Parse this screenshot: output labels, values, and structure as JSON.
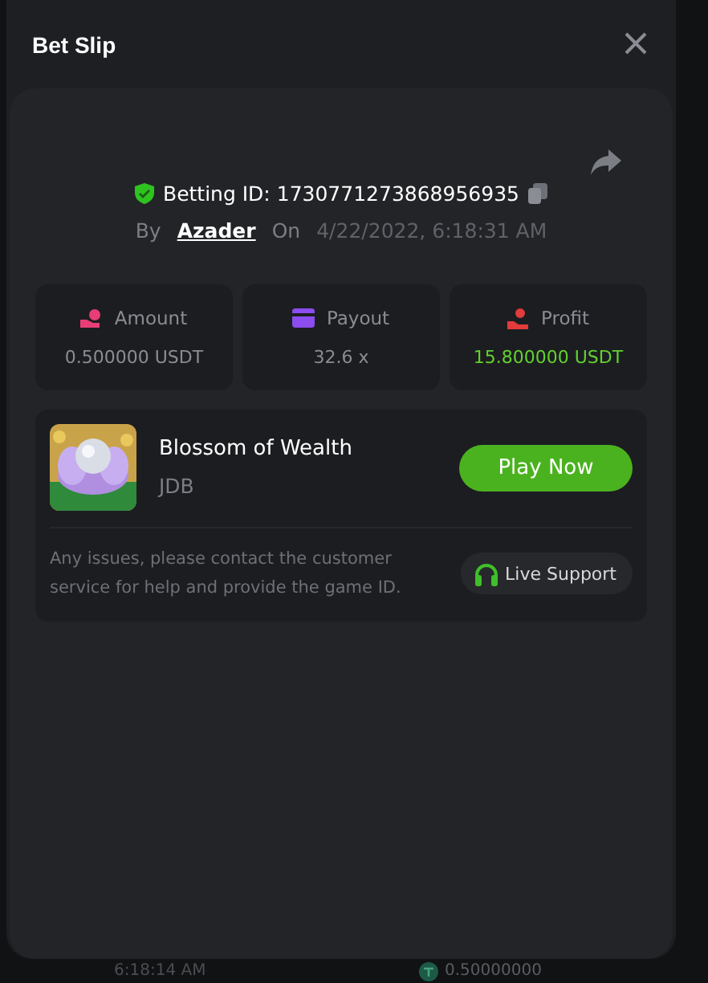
{
  "modal": {
    "title": "Bet Slip",
    "betting_id": "Betting ID: 1730771273868956935",
    "by_label": "By",
    "user": "Azader",
    "on_label": "On",
    "date": "4/22/2022, 6:18:31 AM",
    "stats": [
      {
        "kind": "amount",
        "label": "Amount",
        "value": "0.500000 USDT",
        "color": "#e83e75"
      },
      {
        "kind": "payout",
        "label": "Payout",
        "value": "32.6 x",
        "color": "#8b4cf0"
      },
      {
        "kind": "profit",
        "label": "Profit",
        "value": "15.800000 USDT",
        "color": "#e23b3b"
      }
    ],
    "game": {
      "kind": "picture",
      "name": "Blossom of Wealth",
      "provider": "JDB",
      "play_button": "Play Now"
    },
    "help_text": "Any issues, please contact the customer service for help and provide the game ID.",
    "support_button": "Live Support"
  },
  "background_row": {
    "time": "6:18:14 AM",
    "amount": "0.50000000"
  }
}
